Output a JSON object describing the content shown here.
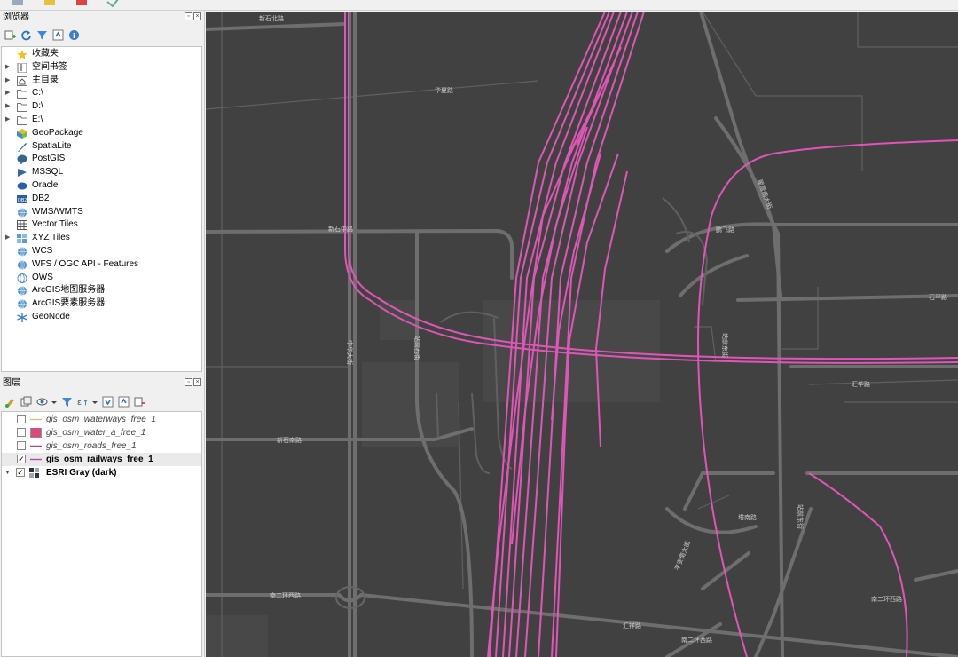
{
  "browser": {
    "title": "浏览器",
    "items": [
      {
        "label": "收藏夹",
        "icon": "star-icon",
        "expandable": false
      },
      {
        "label": "空间书签",
        "icon": "bookmark-icon",
        "expandable": true
      },
      {
        "label": "主目录",
        "icon": "home-folder-icon",
        "expandable": true
      },
      {
        "label": "C:\\",
        "icon": "folder-icon",
        "expandable": true
      },
      {
        "label": "D:\\",
        "icon": "folder-icon",
        "expandable": true
      },
      {
        "label": "E:\\",
        "icon": "folder-icon",
        "expandable": true
      },
      {
        "label": "GeoPackage",
        "icon": "geopackage-icon",
        "expandable": false
      },
      {
        "label": "SpatiaLite",
        "icon": "spatialite-icon",
        "expandable": false
      },
      {
        "label": "PostGIS",
        "icon": "postgis-icon",
        "expandable": false
      },
      {
        "label": "MSSQL",
        "icon": "mssql-icon",
        "expandable": false
      },
      {
        "label": "Oracle",
        "icon": "oracle-icon",
        "expandable": false
      },
      {
        "label": "DB2",
        "icon": "db2-icon",
        "expandable": false
      },
      {
        "label": "WMS/WMTS",
        "icon": "globe-icon",
        "expandable": false
      },
      {
        "label": "Vector Tiles",
        "icon": "grid-icon",
        "expandable": false
      },
      {
        "label": "XYZ Tiles",
        "icon": "tiles-icon",
        "expandable": true
      },
      {
        "label": "WCS",
        "icon": "globe-icon",
        "expandable": false
      },
      {
        "label": "WFS / OGC API - Features",
        "icon": "globe-icon",
        "expandable": false
      },
      {
        "label": "OWS",
        "icon": "globe-outline-icon",
        "expandable": false
      },
      {
        "label": "ArcGIS地图服务器",
        "icon": "globe-icon",
        "expandable": false
      },
      {
        "label": "ArcGIS要素服务器",
        "icon": "globe-icon",
        "expandable": false
      },
      {
        "label": "GeoNode",
        "icon": "geonode-icon",
        "expandable": false
      }
    ]
  },
  "layers": {
    "title": "图层",
    "items": [
      {
        "label": "gis_osm_waterways_free_1",
        "checked": false,
        "style": "italic",
        "symbol": "line",
        "color": "#c8c88c"
      },
      {
        "label": "gis_osm_water_a_free_1",
        "checked": false,
        "style": "italic",
        "symbol": "fill",
        "color": "#d94a7a"
      },
      {
        "label": "gis_osm_roads_free_1",
        "checked": false,
        "style": "italic",
        "symbol": "line",
        "color": "#9b4f7a"
      },
      {
        "label": "gis_osm_railways_free_1",
        "checked": true,
        "style": "bold-underline",
        "symbol": "line",
        "color": "#b04da0"
      },
      {
        "label": "ESRI Gray (dark)",
        "checked": true,
        "style": "bold",
        "symbol": "raster",
        "color": "#333333"
      }
    ]
  },
  "map": {
    "background": "#414141",
    "road_color": "#6a6a6a",
    "rail_color": "#e055b8",
    "road_labels": [
      "新石北路",
      "华夏路",
      "新石中路",
      "中华大街",
      "新石南路",
      "南二环西路",
      "汇华路",
      "南二环西路",
      "汇祥路",
      "石平路",
      "站前西街",
      "站前东街",
      "鹏飞路",
      "平安南大街",
      "塔南路",
      "翟营南大街",
      "站前东街",
      "南二环西路"
    ]
  },
  "colors": {
    "panel_bg": "#f0f0f0",
    "tree_bg": "#ffffff",
    "selection": "#eaeaea"
  }
}
